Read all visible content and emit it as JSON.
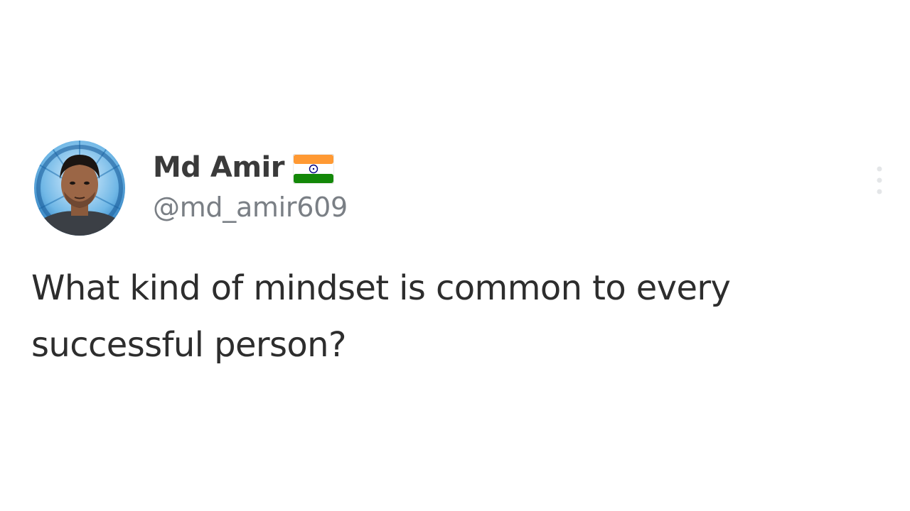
{
  "post": {
    "author": {
      "display_name": "Md Amir",
      "flag_icon": "india-flag-icon",
      "handle": "@md_amir609",
      "avatar_icon": "profile-photo"
    },
    "text": "What kind of mindset is common to every successful person?",
    "more_icon": "more-vertical-icon"
  },
  "colors": {
    "background": "#ffffff",
    "name": "#3a3a3a",
    "handle": "#7a7f85",
    "body_text": "#2d2d2d",
    "flag_saffron": "#ff9933",
    "flag_green": "#138808",
    "flag_chakra": "#000080"
  }
}
